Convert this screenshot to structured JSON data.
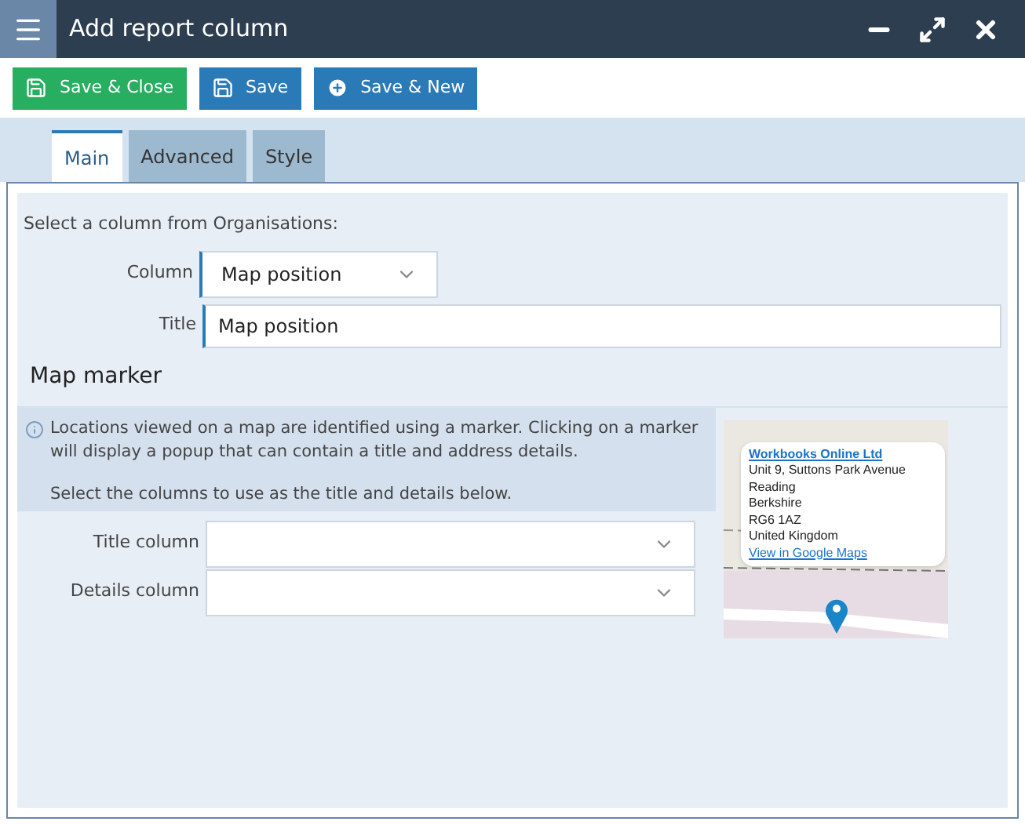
{
  "window": {
    "title": "Add report column"
  },
  "toolbar": [
    {
      "label": "Save & Close",
      "kind": "save",
      "color": "#27ae60"
    },
    {
      "label": "Save",
      "kind": "save",
      "color": "#2a7ab8"
    },
    {
      "label": "Save & New",
      "kind": "new",
      "color": "#2a7ab8"
    }
  ],
  "tabs": [
    {
      "label": "Main",
      "selected": true
    },
    {
      "label": "Advanced",
      "selected": false
    },
    {
      "label": "Style",
      "selected": false
    }
  ],
  "intro": "Select a column from Organisations:",
  "column_field": {
    "label": "Column",
    "value": "Map position"
  },
  "title_field": {
    "label": "Title",
    "value": "Map position"
  },
  "section_title": "Map marker",
  "info": [
    "Locations viewed on a map are identified using a marker. Clicking on a marker will display a popup that can contain a title and address details.",
    "Select the columns to use as the title and details below."
  ],
  "marker_fields": [
    {
      "label": "Title column"
    },
    {
      "label": "Details column"
    }
  ],
  "preview": {
    "link": "Workbooks Online Ltd",
    "lines": [
      "Unit 9, Suttons Park Avenue",
      "Reading",
      "Berkshire",
      "RG6 1AZ",
      "United Kingdom"
    ],
    "map_link": "View in Google Maps"
  }
}
